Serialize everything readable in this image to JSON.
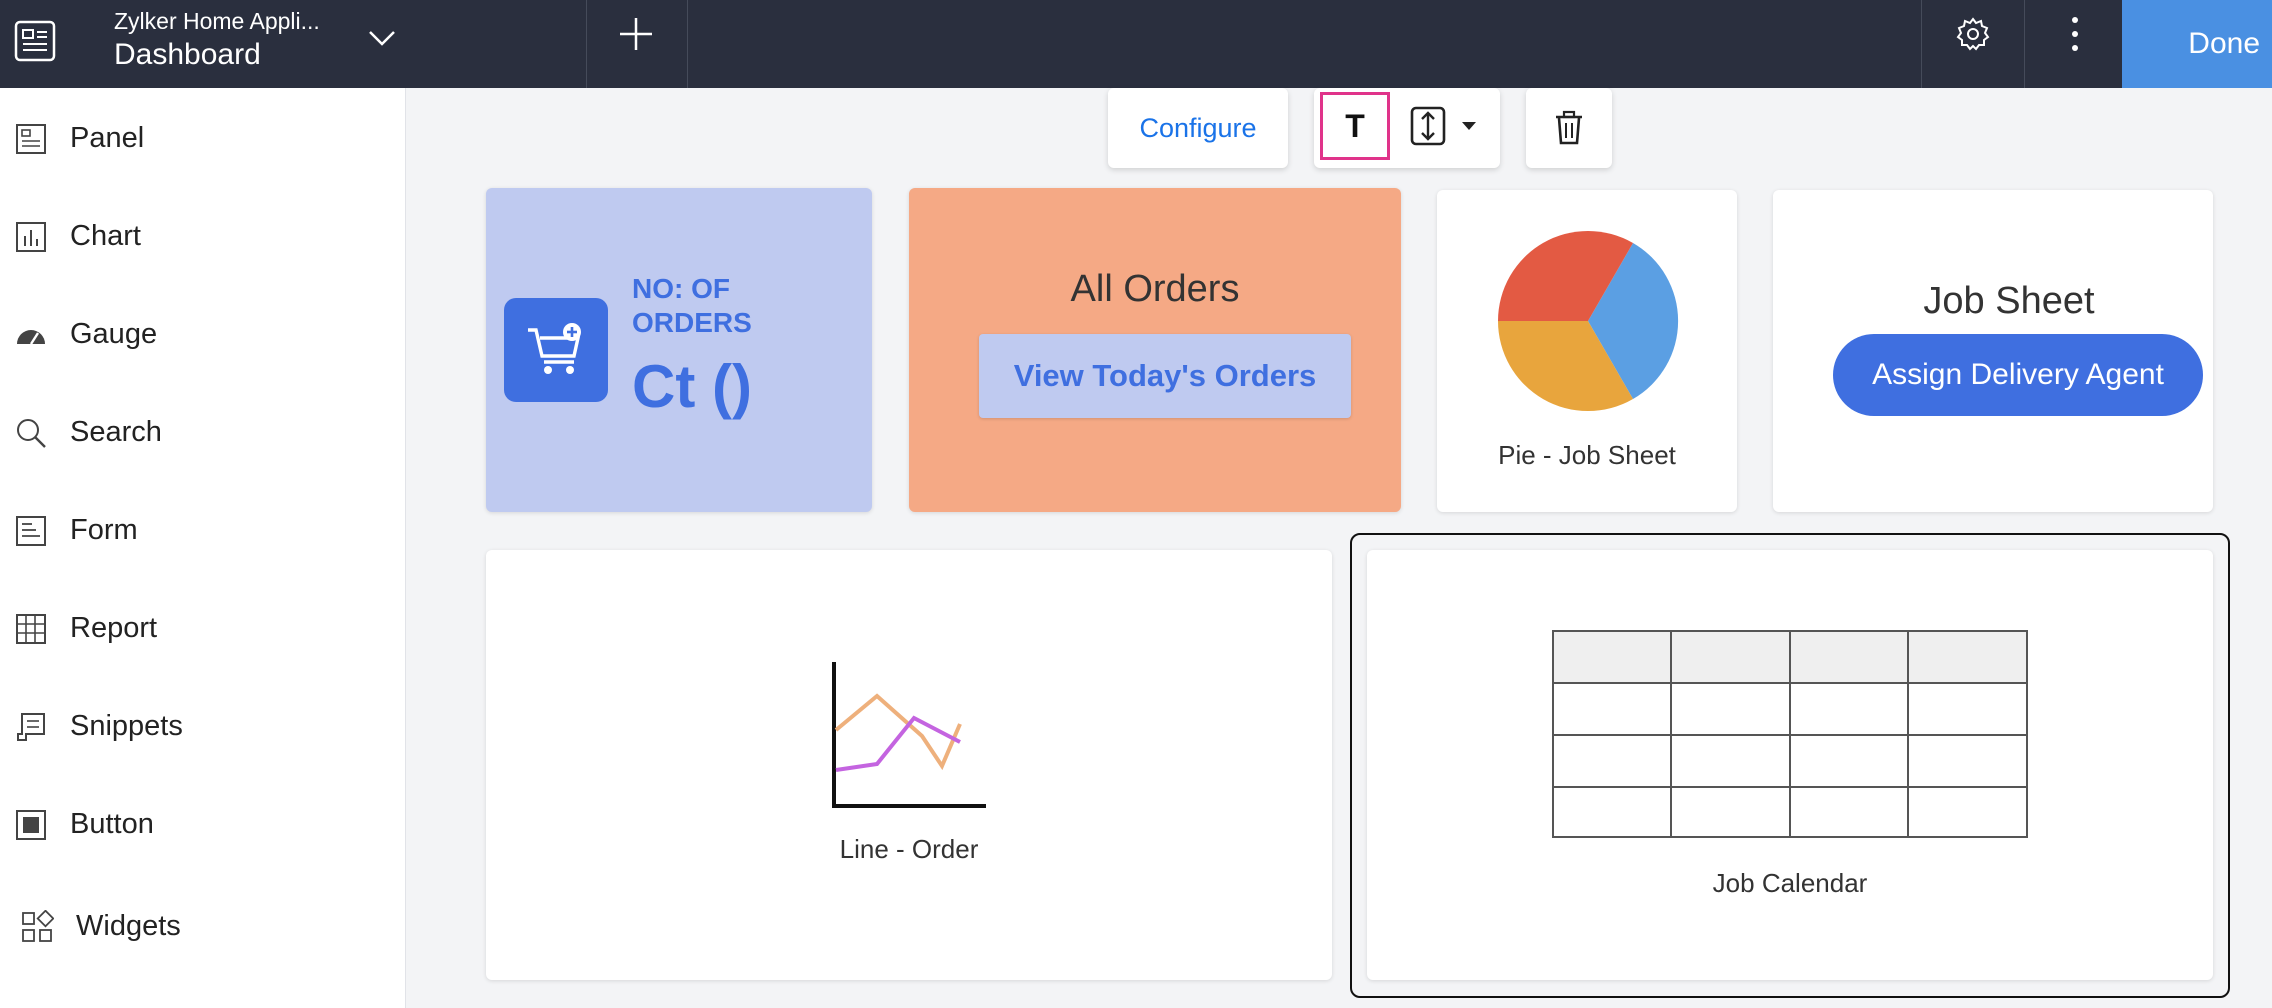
{
  "header": {
    "app_name": "Zylker Home Appli...",
    "page_title": "Dashboard",
    "done_label": "Done"
  },
  "sidebar": {
    "items": [
      {
        "label": "Panel",
        "icon": "panel-icon"
      },
      {
        "label": "Chart",
        "icon": "chart-icon"
      },
      {
        "label": "Gauge",
        "icon": "gauge-icon"
      },
      {
        "label": "Search",
        "icon": "search-icon"
      },
      {
        "label": "Form",
        "icon": "form-icon"
      },
      {
        "label": "Report",
        "icon": "report-icon"
      },
      {
        "label": "Snippets",
        "icon": "snippets-icon"
      },
      {
        "label": "Button",
        "icon": "button-icon"
      },
      {
        "label": "Widgets",
        "icon": "widgets-icon"
      }
    ]
  },
  "toolbar": {
    "configure_label": "Configure",
    "text_label": "T"
  },
  "cards": {
    "orders": {
      "label": "NO: OF ORDERS",
      "value": "Ct ()"
    },
    "all_orders": {
      "title": "All Orders",
      "button": "View Today's Orders"
    },
    "pie": {
      "caption": "Pie - Job Sheet"
    },
    "job_sheet": {
      "title": "Job Sheet",
      "button": "Assign Delivery Agent"
    },
    "line": {
      "caption": "Line - Order"
    },
    "calendar": {
      "caption": "Job Calendar"
    }
  },
  "colors": {
    "topbar": "#2a2f3e",
    "accent": "#3f6fe0",
    "done": "#4a90e2",
    "orders_card": "#bfcaf0",
    "all_orders_card": "#f5a985",
    "selection_highlight": "#e0338a"
  }
}
